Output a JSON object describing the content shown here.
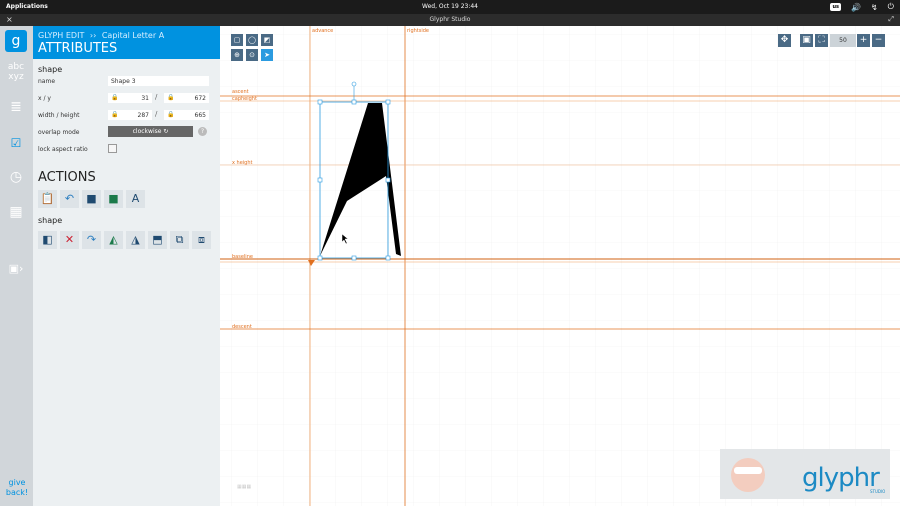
{
  "system": {
    "apps_label": "Applications",
    "clock": "Wed, Oct 19   23:44",
    "kbd_layout": "us",
    "window_title": "Glyphr Studio"
  },
  "rail": {
    "items": [
      {
        "name": "glyphr-logo-icon"
      },
      {
        "name": "character-set-icon",
        "label": "abc xyz"
      },
      {
        "name": "layers-icon"
      },
      {
        "name": "attributes-icon"
      },
      {
        "name": "history-icon"
      },
      {
        "name": "guides-icon"
      },
      {
        "name": "save-icon"
      }
    ],
    "give_back": "give back!"
  },
  "panel": {
    "crumb_mode": "GLYPH EDIT",
    "crumb_sep": "››",
    "crumb_glyph": "Capital Letter A",
    "title": "ATTRIBUTES",
    "shape_section": "shape",
    "name_label": "name",
    "name_value": "Shape 3",
    "xy_label": "x  /  y",
    "x_value": "31",
    "y_value": "672",
    "wh_label": "width  /  height",
    "width_value": "287",
    "height_value": "665",
    "overlap_label": "overlap mode",
    "overlap_value": "clockwise  ↻",
    "help": "?",
    "lock_label": "lock aspect ratio",
    "actions_title": "ACTIONS",
    "actions_shape_section": "shape"
  },
  "canvas": {
    "guides": {
      "advance": "advance",
      "ascent": "ascent",
      "capheight": "capheight",
      "xheight": "x height",
      "baseline": "baseline",
      "descent": "descent",
      "rightside": "rightside"
    },
    "zoom": "50"
  },
  "logo": {
    "text": "glyphr",
    "sub": "STUDIO"
  },
  "colors": {
    "accent": "#0092e0",
    "guide": "#e07020",
    "selection": "#2b9be0"
  }
}
